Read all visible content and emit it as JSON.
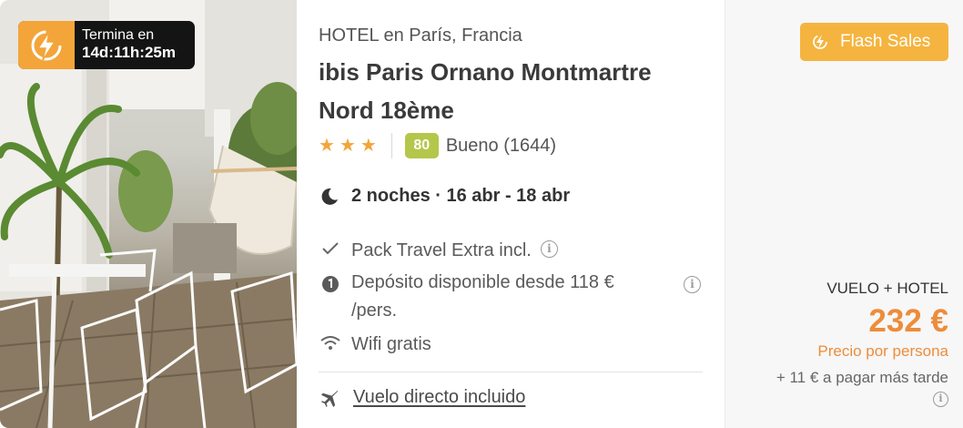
{
  "timer": {
    "label": "Termina en",
    "countdown": "14d:11h:25m"
  },
  "hotel": {
    "location": "HOTEL en París, Francia",
    "name": "ibis Paris Ornano Montmartre Nord 18ème",
    "stars": 3,
    "score": "80",
    "score_text": "Bueno (1644)"
  },
  "stay": {
    "nights": "2 noches · 16 abr - 18 abr"
  },
  "features": {
    "pack": "Pack Travel Extra incl.",
    "deposit": "Depósito disponible desde 118 € /pers.",
    "wifi": "Wifi gratis"
  },
  "flight": {
    "link": "Vuelo directo incluido"
  },
  "price": {
    "badge": "Flash Sales",
    "package": "VUELO + HOTEL",
    "amount": "232 €",
    "per": "Precio por persona",
    "extra": "+ 11 € a pagar más tarde"
  },
  "colors": {
    "accent": "#f3a53a",
    "price": "#ee8c3a",
    "score": "#b4c74a",
    "badge": "#f5b43f"
  },
  "icons": {
    "timer": "lightning-icon",
    "star": "star-icon",
    "night": "moon-icon",
    "pack": "check-icon",
    "deposit": "deposit-icon",
    "wifi": "wifi-icon",
    "flight": "plane-icon",
    "flash": "flash-icon",
    "info": "info-icon"
  }
}
